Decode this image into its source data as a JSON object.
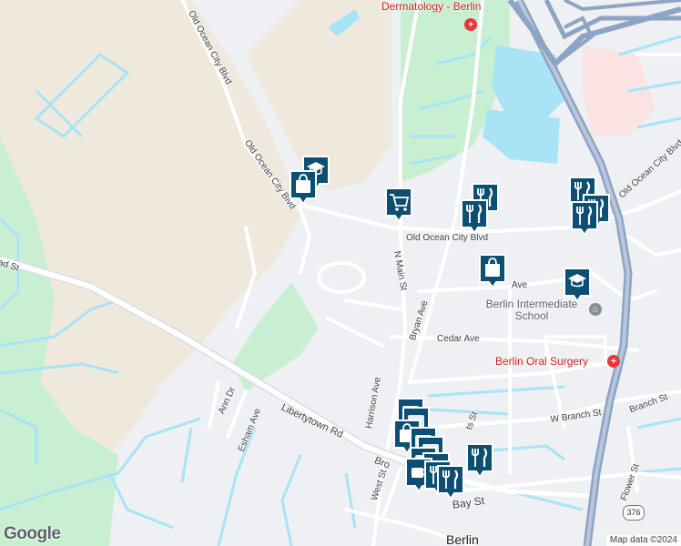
{
  "map": {
    "colors": {
      "background": "#eef0f3",
      "farmland": "#efe9dd",
      "park": "#c9efd2",
      "water": "#a8e4f5",
      "highway": "#8ea4c4",
      "road": "#ffffff",
      "medical": "#e8383d",
      "marker": "#0d4f72"
    }
  },
  "roads": [
    {
      "id": "old-ocean-city-blvd-west",
      "label": "Old Ocean City Blvd"
    },
    {
      "id": "old-ocean-city-blvd-mid",
      "label": "Old Ocean City Blvd"
    },
    {
      "id": "old-ocean-city-blvd-east",
      "label": "Old Ocean City Blvd"
    },
    {
      "id": "old-ocean-city-blvd-right",
      "label": "Old Ocean City Blvd"
    },
    {
      "id": "n-main-st",
      "label": "N Main St"
    },
    {
      "id": "bryan-ave",
      "label": "Bryan Ave"
    },
    {
      "id": "cedar-ave",
      "label": "Cedar Ave"
    },
    {
      "id": "harrison-ave",
      "label": "Harrison Ave"
    },
    {
      "id": "libertytown-rd",
      "label": "Libertytown Rd"
    },
    {
      "id": "ann-dr",
      "label": "Ann Dr"
    },
    {
      "id": "esham-ave",
      "label": "Esham Ave"
    },
    {
      "id": "ad-st",
      "label": "ad St"
    },
    {
      "id": "w-branch-st",
      "label": "W Branch St"
    },
    {
      "id": "branch-st",
      "label": "Branch St"
    },
    {
      "id": "flower-st",
      "label": "Flower St"
    },
    {
      "id": "west-st",
      "label": "West St"
    },
    {
      "id": "bay-st",
      "label": "Bay St"
    },
    {
      "id": "bro",
      "label": "Bro"
    },
    {
      "id": "ave-frag",
      "label": "Ave"
    },
    {
      "id": "ts-st",
      "label": "ts St"
    }
  ],
  "pois": [
    {
      "id": "dermatology",
      "label": "Dermatology - Berlin"
    },
    {
      "id": "oral-surgery",
      "label": "Berlin Oral Surgery"
    },
    {
      "id": "school",
      "label": "Berlin Intermediate School"
    }
  ],
  "city": {
    "label": "Berlin"
  },
  "highway_shield": {
    "label": "376"
  },
  "markers": [
    {
      "id": "m1",
      "icon": "school"
    },
    {
      "id": "m2",
      "icon": "shopping-bag"
    },
    {
      "id": "m3",
      "icon": "shopping-cart"
    },
    {
      "id": "m4",
      "icon": "restaurant"
    },
    {
      "id": "m5",
      "icon": "restaurant"
    },
    {
      "id": "m6",
      "icon": "restaurant"
    },
    {
      "id": "m7",
      "icon": "restaurant"
    },
    {
      "id": "m8",
      "icon": "restaurant"
    },
    {
      "id": "m9",
      "icon": "shopping-bag"
    },
    {
      "id": "m10",
      "icon": "school"
    },
    {
      "id": "m11",
      "icon": "cluster"
    },
    {
      "id": "m12",
      "icon": "cluster"
    },
    {
      "id": "m13",
      "icon": "shopping-bag"
    },
    {
      "id": "m14",
      "icon": "cluster"
    },
    {
      "id": "m15",
      "icon": "cluster"
    },
    {
      "id": "m16",
      "icon": "cluster"
    },
    {
      "id": "m17",
      "icon": "cluster"
    },
    {
      "id": "m18",
      "icon": "restaurant"
    },
    {
      "id": "m19",
      "icon": "cafe"
    },
    {
      "id": "m20",
      "icon": "restaurant"
    },
    {
      "id": "m21",
      "icon": "restaurant"
    }
  ],
  "footer": {
    "logo": "Google",
    "attribution": "Map data ©2024"
  }
}
